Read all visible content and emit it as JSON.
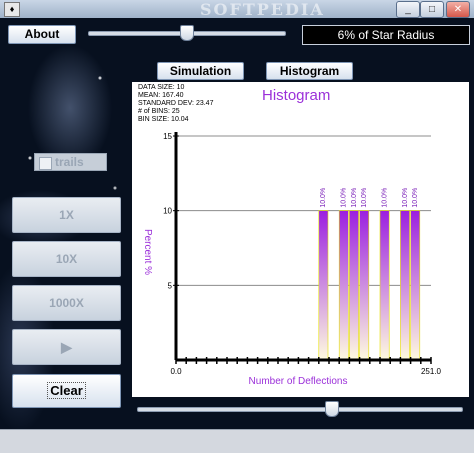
{
  "window": {
    "watermark": "SOFTPEDIA",
    "controls": [
      "_",
      "□",
      "✕"
    ]
  },
  "toolbar": {
    "about_label": "About",
    "slider_value": 0.5,
    "radius_readout": "6% of Star Radius"
  },
  "tabs": {
    "simulation_label": "Simulation",
    "histogram_label": "Histogram"
  },
  "controls": {
    "trails_label": "trails",
    "trails_checked": false,
    "speed_1x": "1X",
    "speed_10x": "10X",
    "speed_1000x": "1000X",
    "play_glyph": "▶",
    "clear_label": "Clear"
  },
  "stats": {
    "line1": "DATA SIZE:  10",
    "line2": "MEAN:  167.40",
    "line3": "STANDARD DEV:  23.47",
    "line4": "# of BINS:  25",
    "line5": "BIN SIZE:  10.04"
  },
  "histogram_slider_value": 0.6,
  "colors": {
    "bar_top": "#9b1fe0",
    "bar_bottom": "#fffbe0",
    "title": "#9b30d9"
  },
  "chart_data": {
    "type": "bar",
    "title": "Histogram",
    "xlabel": "Number of Deflections",
    "ylabel": "Percent %",
    "xlim": [
      0.0,
      251.0
    ],
    "ylim": [
      0,
      15
    ],
    "x_tick_labels": [
      "0.0",
      "251.0"
    ],
    "y_ticks": [
      5,
      10,
      15
    ],
    "grid": true,
    "bars": [
      {
        "x_start": 140.56,
        "x_end": 150.6,
        "value": 10.0,
        "label": "10.0%"
      },
      {
        "x_start": 160.64,
        "x_end": 170.68,
        "value": 10.0,
        "label": "10.0%"
      },
      {
        "x_start": 170.68,
        "x_end": 180.72,
        "value": 10.0,
        "label": "10.0%"
      },
      {
        "x_start": 180.72,
        "x_end": 190.76,
        "value": 10.0,
        "label": "10.0%"
      },
      {
        "x_start": 200.8,
        "x_end": 210.84,
        "value": 10.0,
        "label": "10.0%"
      },
      {
        "x_start": 220.88,
        "x_end": 230.92,
        "value": 10.0,
        "label": "10.0%"
      },
      {
        "x_start": 230.92,
        "x_end": 240.96,
        "value": 10.0,
        "label": "10.0%"
      },
      {
        "x_start": 250.0,
        "x_end": 251.0,
        "value": 0.0,
        "label": ""
      }
    ]
  }
}
